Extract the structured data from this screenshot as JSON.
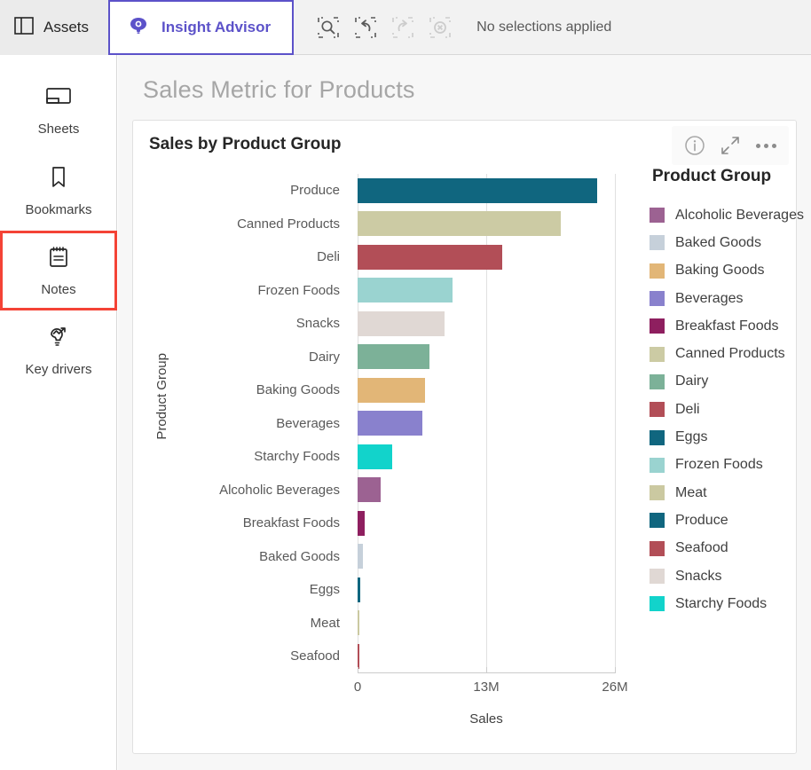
{
  "topbar": {
    "assets_label": "Assets",
    "advisor_label": "Insight Advisor",
    "selection_status": "No selections applied",
    "accent_color": "#5c52c9",
    "progress_color": "#00873d",
    "tools": [
      {
        "name": "selection-search-icon",
        "label": "Search selections"
      },
      {
        "name": "step-back-icon",
        "label": "Step back"
      },
      {
        "name": "step-forward-icon",
        "label": "Step forward"
      },
      {
        "name": "clear-selections-icon",
        "label": "Clear all selections"
      }
    ]
  },
  "sidebar": {
    "items": [
      {
        "label": "Sheets",
        "icon": "sheets-icon",
        "highlighted": false
      },
      {
        "label": "Bookmarks",
        "icon": "bookmark-icon",
        "highlighted": false
      },
      {
        "label": "Notes",
        "icon": "notes-icon",
        "highlighted": true
      },
      {
        "label": "Key drivers",
        "icon": "key-drivers-icon",
        "highlighted": false
      }
    ],
    "highlight_color": "#f44336"
  },
  "main": {
    "page_title": "Sales Metric for Products",
    "card": {
      "title": "Sales by Product Group",
      "tools": [
        {
          "name": "info-icon",
          "label": "Information"
        },
        {
          "name": "expand-icon",
          "label": "Fullscreen"
        },
        {
          "name": "more-options-icon",
          "label": "More options"
        }
      ]
    }
  },
  "chart_data": {
    "type": "bar",
    "orientation": "horizontal",
    "title": "Sales by Product Group",
    "xlabel": "Sales",
    "ylabel": "Product Group",
    "xlim": [
      0,
      26000000
    ],
    "xticks": [
      0,
      13000000,
      26000000
    ],
    "xtick_labels": [
      "0",
      "13M",
      "26M"
    ],
    "grid": true,
    "legend_title": "Product Group",
    "legend_position": "right",
    "categories": [
      "Produce",
      "Canned Products",
      "Deli",
      "Frozen Foods",
      "Snacks",
      "Dairy",
      "Baking Goods",
      "Beverages",
      "Starchy Foods",
      "Alcoholic Beverages",
      "Breakfast Foods",
      "Baked Goods",
      "Eggs",
      "Meat",
      "Seafood"
    ],
    "values": [
      24200000,
      20500000,
      14600000,
      9600000,
      8800000,
      7300000,
      6800000,
      6500000,
      3500000,
      2300000,
      700000,
      500000,
      300000,
      100000,
      80000
    ],
    "colors": [
      "#10667f",
      "#cccba4",
      "#b24e57",
      "#9ad3d0",
      "#e0d8d4",
      "#7cb198",
      "#e2b677",
      "#8981cd",
      "#12d3cb",
      "#9c6292",
      "#8e1f5f",
      "#c6d0da",
      "#10667f",
      "#cbc9a1",
      "#b24e57"
    ],
    "legend_entries": [
      {
        "label": "Alcoholic Beverages",
        "color": "#9c6292"
      },
      {
        "label": "Baked Goods",
        "color": "#c6d0da"
      },
      {
        "label": "Baking Goods",
        "color": "#e2b677"
      },
      {
        "label": "Beverages",
        "color": "#8981cd"
      },
      {
        "label": "Breakfast Foods",
        "color": "#8e1f5f"
      },
      {
        "label": "Canned Products",
        "color": "#cccba4"
      },
      {
        "label": "Dairy",
        "color": "#7cb198"
      },
      {
        "label": "Deli",
        "color": "#b24e57"
      },
      {
        "label": "Eggs",
        "color": "#10667f"
      },
      {
        "label": "Frozen Foods",
        "color": "#9ad3d0"
      },
      {
        "label": "Meat",
        "color": "#cbc9a1"
      },
      {
        "label": "Produce",
        "color": "#10667f"
      },
      {
        "label": "Seafood",
        "color": "#b24e57"
      },
      {
        "label": "Snacks",
        "color": "#e0d8d4"
      },
      {
        "label": "Starchy Foods",
        "color": "#12d3cb"
      }
    ]
  }
}
